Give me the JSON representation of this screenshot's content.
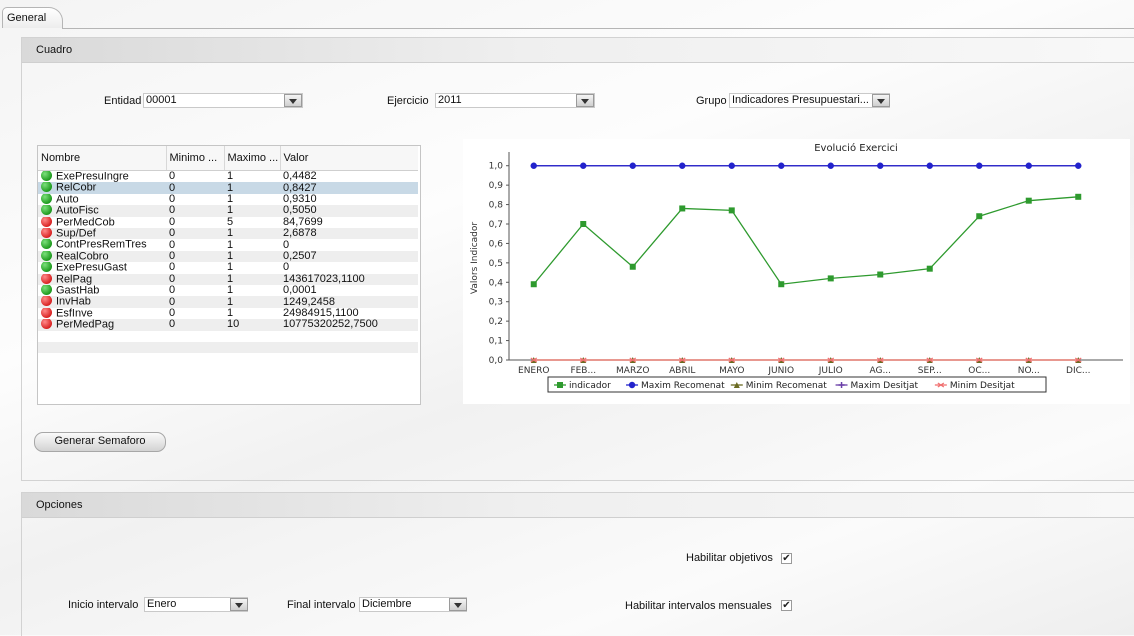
{
  "tabs": [
    {
      "label": "General"
    }
  ],
  "cuadro": {
    "title": "Cuadro",
    "entidad": {
      "label": "Entidad",
      "value": "00001"
    },
    "ejercicio": {
      "label": "Ejercicio",
      "value": "2011"
    },
    "grupo": {
      "label": "Grupo",
      "value": "Indicadores Presupuestari..."
    },
    "table": {
      "columns": [
        "Nombre",
        "Minimo ...",
        "Maximo ...",
        "Valor"
      ],
      "rows": [
        {
          "status": "green",
          "nombre": "ExePresuIngre",
          "minimo": "0",
          "maximo": "1",
          "valor": "0,4482"
        },
        {
          "status": "green",
          "nombre": "RelCobr",
          "minimo": "0",
          "maximo": "1",
          "valor": "0,8427"
        },
        {
          "status": "green",
          "nombre": "Auto",
          "minimo": "0",
          "maximo": "1",
          "valor": "0,9310"
        },
        {
          "status": "green",
          "nombre": "AutoFisc",
          "minimo": "0",
          "maximo": "1",
          "valor": "0,5050"
        },
        {
          "status": "red",
          "nombre": "PerMedCob",
          "minimo": "0",
          "maximo": "5",
          "valor": "84,7699"
        },
        {
          "status": "red",
          "nombre": "Sup/Def",
          "minimo": "0",
          "maximo": "1",
          "valor": "2,6878"
        },
        {
          "status": "green",
          "nombre": "ContPresRemTres",
          "minimo": "0",
          "maximo": "1",
          "valor": "0"
        },
        {
          "status": "green",
          "nombre": "RealCobro",
          "minimo": "0",
          "maximo": "1",
          "valor": "0,2507"
        },
        {
          "status": "green",
          "nombre": "ExePresuGast",
          "minimo": "0",
          "maximo": "1",
          "valor": "0"
        },
        {
          "status": "red",
          "nombre": "RelPag",
          "minimo": "0",
          "maximo": "1",
          "valor": "143617023,1100"
        },
        {
          "status": "green",
          "nombre": "GastHab",
          "minimo": "0",
          "maximo": "1",
          "valor": "0,0001"
        },
        {
          "status": "red",
          "nombre": "InvHab",
          "minimo": "0",
          "maximo": "1",
          "valor": "1249,2458"
        },
        {
          "status": "red",
          "nombre": "EsfInve",
          "minimo": "0",
          "maximo": "1",
          "valor": "24984915,1100"
        },
        {
          "status": "red",
          "nombre": "PerMedPag",
          "minimo": "0",
          "maximo": "10",
          "valor": "10775320252,7500"
        }
      ],
      "selected_row": 1
    },
    "button": "Generar Semaforo"
  },
  "chart_data": {
    "type": "line",
    "title": "Evolució Exercici",
    "ylabel": "Valors Indicador",
    "xlabel": "",
    "categories": [
      "ENERO",
      "FEB...",
      "MARZO",
      "ABRIL",
      "MAYO",
      "JUNIO",
      "JULIO",
      "AG...",
      "SEP...",
      "OC...",
      "NO...",
      "DIC..."
    ],
    "ylim": [
      0,
      1.05
    ],
    "yticks": [
      "0,0",
      "0,1",
      "0,2",
      "0,3",
      "0,4",
      "0,5",
      "0,6",
      "0,7",
      "0,8",
      "0,9",
      "1,0"
    ],
    "series": [
      {
        "name": "indicador",
        "color": "#2e9a2e",
        "marker": "square",
        "values": [
          0.39,
          0.7,
          0.48,
          0.78,
          0.77,
          0.39,
          0.42,
          0.44,
          0.47,
          0.74,
          0.82,
          0.84
        ]
      },
      {
        "name": "Maxim Recomenat",
        "color": "#2222cc",
        "marker": "circle",
        "values": [
          1,
          1,
          1,
          1,
          1,
          1,
          1,
          1,
          1,
          1,
          1,
          1
        ]
      },
      {
        "name": "Minim Recomenat",
        "color": "#6b6b22",
        "marker": "triangle",
        "values": [
          0,
          0,
          0,
          0,
          0,
          0,
          0,
          0,
          0,
          0,
          0,
          0
        ]
      },
      {
        "name": "Maxim Desitjat",
        "color": "#6a3fa8",
        "marker": "cross",
        "values": [
          1,
          1,
          1,
          1,
          1,
          1,
          1,
          1,
          1,
          1,
          1,
          1
        ]
      },
      {
        "name": "Minim Desitjat",
        "color": "#f07070",
        "marker": "dash",
        "values": [
          0,
          0,
          0,
          0,
          0,
          0,
          0,
          0,
          0,
          0,
          0,
          0
        ]
      }
    ],
    "grid": false,
    "legend": "bottom"
  },
  "opciones": {
    "title": "Opciones",
    "habilitar_objetivos": {
      "label": "Habilitar objetivos",
      "checked": true
    },
    "habilitar_intervalos": {
      "label": "Habilitar intervalos mensuales",
      "checked": true
    },
    "inicio": {
      "label": "Inicio intervalo",
      "value": "Enero"
    },
    "final": {
      "label": "Final intervalo",
      "value": "Diciembre"
    }
  }
}
